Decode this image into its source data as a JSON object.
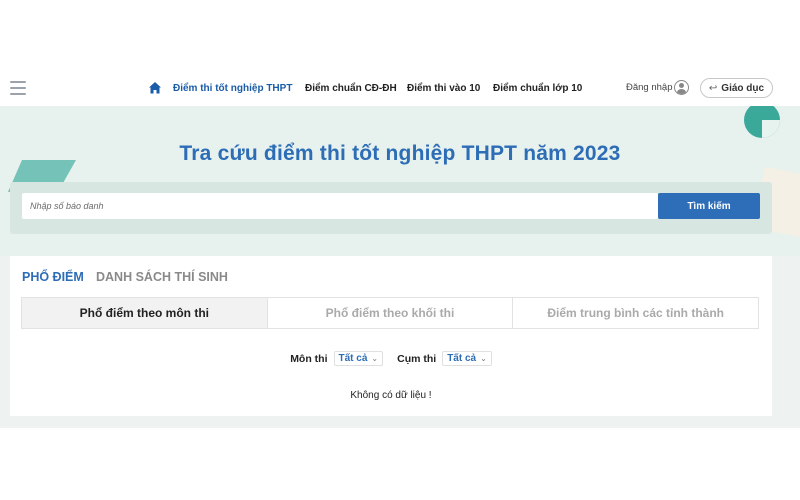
{
  "nav": {
    "items": [
      {
        "label": "Điểm thi tốt nghiệp THPT",
        "active": true
      },
      {
        "label": "Điểm chuẩn CĐ-ĐH",
        "active": false
      },
      {
        "label": "Điểm thi vào 10",
        "active": false
      },
      {
        "label": "Điểm chuẩn lớp 10",
        "active": false
      }
    ],
    "login_label": "Đăng nhập",
    "edu_label": "Giáo dục",
    "icons": [
      "menu-icon",
      "home-icon",
      "user-icon",
      "back-arrow-icon"
    ]
  },
  "hero": {
    "title": "Tra cứu điểm thi tốt nghiệp THPT năm 2023",
    "search_placeholder": "Nhập số báo danh",
    "search_button": "Tìm kiếm"
  },
  "results": {
    "tabs": [
      "PHỔ ĐIỂM",
      "DANH SÁCH THÍ SINH"
    ],
    "subtabs": [
      "Phổ điểm theo môn thi",
      "Phổ điểm theo khối thi",
      "Điểm trung bình các tỉnh thành"
    ],
    "filters": [
      {
        "label": "Môn thi",
        "value": "Tất cả"
      },
      {
        "label": "Cụm thi",
        "value": "Tất cả"
      }
    ],
    "empty_message": "Không có dữ liệu !"
  },
  "colors": {
    "accent": "#2d6db5",
    "hero_bg": "#e7f1ee",
    "button_bg": "#2e6db7"
  }
}
